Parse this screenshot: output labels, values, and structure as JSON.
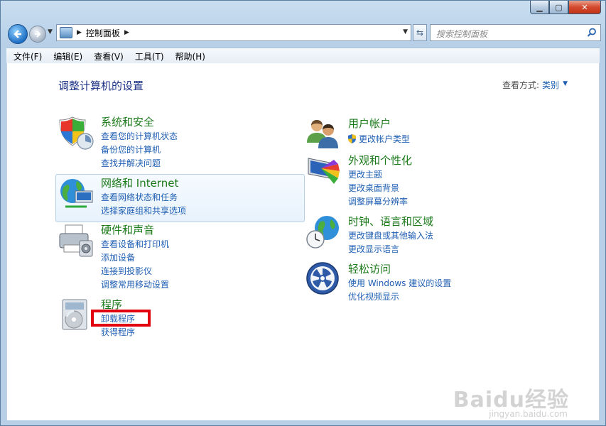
{
  "address": {
    "crumb": "控制面板"
  },
  "search": {
    "placeholder": "搜索控制面板"
  },
  "menu": [
    "文件(F)",
    "编辑(E)",
    "查看(V)",
    "工具(T)",
    "帮助(H)"
  ],
  "page": {
    "title": "调整计算机的设置",
    "view_by_label": "查看方式:",
    "view_by_value": "类别"
  },
  "categories_left": [
    {
      "title": "系统和安全",
      "icon": "shield-icon",
      "links": [
        "查看您的计算机状态",
        "备份您的计算机",
        "查找并解决问题"
      ]
    },
    {
      "title": "网络和 Internet",
      "icon": "network-globe-icon",
      "links": [
        "查看网络状态和任务",
        "选择家庭组和共享选项"
      ]
    },
    {
      "title": "硬件和声音",
      "icon": "printer-icon",
      "links": [
        "查看设备和打印机",
        "添加设备",
        "连接到投影仪",
        "调整常用移动设置"
      ]
    },
    {
      "title": "程序",
      "icon": "programs-icon",
      "links": [
        "卸载程序",
        "获得程序"
      ]
    }
  ],
  "categories_right": [
    {
      "title": "用户帐户",
      "icon": "users-icon",
      "links": [
        "更改帐户类型"
      ]
    },
    {
      "title": "外观和个性化",
      "icon": "monitor-palette-icon",
      "links": [
        "更改主题",
        "更改桌面背景",
        "调整屏幕分辨率"
      ]
    },
    {
      "title": "时钟、语言和区域",
      "icon": "clock-globe-icon",
      "links": [
        "更改键盘或其他输入法",
        "更改显示语言"
      ]
    },
    {
      "title": "轻松访问",
      "icon": "ease-of-access-icon",
      "links": [
        "使用 Windows 建议的设置",
        "优化视频显示"
      ]
    }
  ],
  "watermark": {
    "text": "Baidu经验",
    "sub": "jingyan.baidu.com"
  },
  "colors": {
    "category_title": "#1b7a19",
    "link": "#1f5fb3",
    "highlight_box": "#e3000e"
  }
}
